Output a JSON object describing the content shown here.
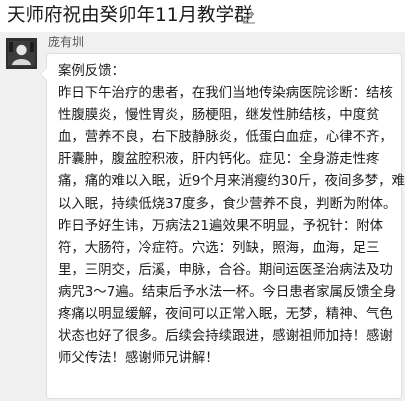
{
  "header": {
    "title": "天师府祝由癸卯年11月教学群",
    "edit_icon": "pencil-edit-icon"
  },
  "message": {
    "sender": "庞有圳",
    "avatar_icon": "user-avatar",
    "lines": [
      "案例反馈：",
      "昨日下午治疗的患者，在我们当地传染病医院诊断：结核",
      "性腹膜炎，慢性胃炎，肠梗阻，继发性肺结核，中度贫",
      "血，营养不良，右下肢静脉炎，低蛋白血症，心律不齐，",
      "肝囊肿，腹盆腔积液，肝内钙化。症见：全身游走性疼",
      "痛，痛的难以入眠，近9个月来消瘦约30斤，夜间多梦，难",
      "以入眠，持续低烧37度多，食少营养不良，判断为附体。",
      "昨日予好生讳，万病法21遍效果不明显，予祝针：附体",
      "符，大肠符，冷症符。穴选：列缺，照海，血海，足三",
      "里，三阴交，后溪，申脉，合谷。期间运医圣治病法及功",
      "病咒3～7遍。结束后予水法一杯。今日患者家属反馈全身",
      "疼痛以明显缓解，夜间可以正常入眠，无梦，精神、气色",
      "状态也好了很多。后续会持续跟进，感谢祖师加持！感谢",
      "师父传法！感谢师兄讲解！"
    ]
  }
}
